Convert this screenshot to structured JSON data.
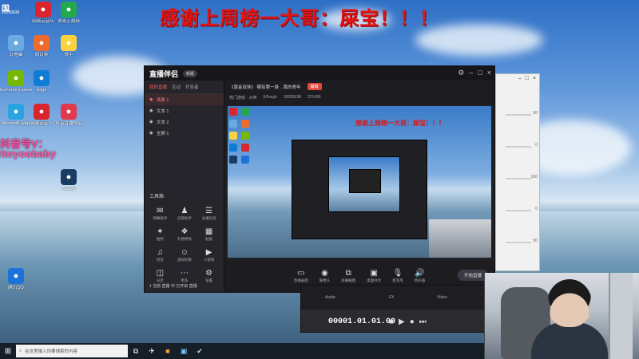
{
  "headline": "感谢上周榜一大哥：屎宝！！！",
  "corner": {
    "title": "国",
    "sub": "10290638"
  },
  "desktop_icons": [
    {
      "label": "网易云音乐",
      "icon": "netease-icon",
      "color": "#d9262d"
    },
    {
      "label": "爱奇艺视频",
      "icon": "iqiyi-icon",
      "color": "#23a94b"
    },
    {
      "label": "此电脑",
      "icon": "computer-icon",
      "color": "#6aaae0"
    },
    {
      "label": "向日葵",
      "icon": "sunlogin-icon",
      "color": "#ef6b2c"
    },
    {
      "label": "快手",
      "icon": "kuaishou-icon",
      "color": "#fbd341"
    },
    {
      "label": "GeForce Experience",
      "icon": "nvidia-icon",
      "color": "#76b900"
    },
    {
      "label": "Edge",
      "icon": "edge-icon",
      "color": "#0f7cd6"
    },
    {
      "label": "Microsoft Edge",
      "icon": "edge-icon",
      "color": "#2aa4e0"
    },
    {
      "label": "网易云音乐",
      "icon": "music-icon",
      "color": "#d9262d"
    },
    {
      "label": "抖音直播伴侣",
      "icon": "douyin-icon",
      "color": "#e23a4d"
    },
    {
      "label": "Steam",
      "icon": "steam-icon",
      "color": "#1a3c63"
    },
    {
      "label": "腾讯QQ",
      "icon": "qq-icon",
      "color": "#1a73d9"
    }
  ],
  "overlay_text": {
    "line1": "抖音号V：",
    "line2": "ttoyoobaby"
  },
  "app": {
    "logo": "直播伴侣",
    "badge": "新版",
    "tabs": [
      "我的直播",
      "互动",
      "开发者"
    ],
    "scenes": [
      "场景 1",
      "文本 1",
      "文本 2",
      "全屏 1"
    ],
    "tools_title": "工具箱",
    "tools": [
      "弹幕助手",
      "房管助手",
      "主播任务",
      "抽奖",
      "礼物特效",
      "贴纸",
      "语音",
      "虚拟形象",
      "小游戏",
      "分区",
      "更多",
      "设置"
    ],
    "footer": "1 当前 直播 中 已开启 直播",
    "info_title": "《黄金双侠》 哪有第一身…我的青年",
    "info_button": "编辑",
    "info_sub": [
      "热门游戏 · 大神",
      "0/5vsyb",
      "10055638",
      "221436"
    ],
    "preview_headline": "感谢上周榜一大哥：屎宝！！！",
    "bottom_tools": [
      "直播画面",
      "摄像头",
      "屏幕截图",
      "桌面共享",
      "麦克风",
      "扬声器"
    ],
    "start_label": "开始直播"
  },
  "settings": {
    "values": [
      "50",
      "0",
      "100",
      "0",
      "50"
    ]
  },
  "editor": {
    "timecode": "00001.01.01.00",
    "tracks": [
      "Audio",
      "FX",
      "Video"
    ]
  },
  "taskbar": {
    "search_placeholder": "在这里输入你要搜索的内容"
  }
}
